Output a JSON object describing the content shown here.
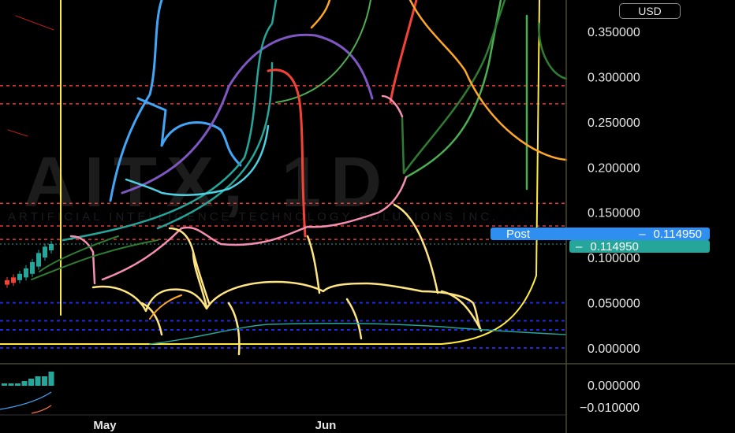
{
  "watermark": {
    "symbol": "AITX, 1D",
    "company": "ARTIFICIAL INTELLIGENCE TECHNOLOGY SOLUTIONS INC."
  },
  "currency_button": {
    "label": "USD"
  },
  "price_tags": {
    "post": {
      "label": "Post",
      "value": "0.114950"
    },
    "last": {
      "value": "0.114950"
    }
  },
  "colors": {
    "background": "#000000",
    "yellow": "#ffeb3b",
    "light_yellow": "#ffe57f",
    "blue": "#42a5f5",
    "purple": "#7e57c2",
    "teal": "#26a69a",
    "green": "#4caf50",
    "dark_green": "#2e7d32",
    "red": "#f44336",
    "orange": "#ffa726",
    "pink": "#f48fb1",
    "cyan": "#4dd0e1",
    "dashed_red": "#e53935",
    "dashed_blue": "#1e2bd8"
  },
  "chart_data": {
    "type": "line",
    "y_axis": {
      "ticks": [
        "0.350000",
        "0.300000",
        "0.250000",
        "0.200000",
        "0.150000",
        "0.100000",
        "0.050000",
        "0.000000"
      ],
      "ylim": [
        0,
        0.35
      ]
    },
    "x_axis": {
      "ticks": [
        "May",
        "Jun"
      ]
    },
    "horizontal_levels": {
      "red_dashed": [
        0.29,
        0.27,
        0.16,
        0.135,
        0.12
      ],
      "blue_dashed": [
        0.05,
        0.03,
        0.02,
        0.0
      ]
    },
    "last_price": 0.11495,
    "volume_pane": {
      "ticks": [
        "0.000000",
        "−0.010000"
      ],
      "bars": [
        1,
        1,
        1,
        2,
        3,
        4,
        4,
        6
      ]
    }
  }
}
